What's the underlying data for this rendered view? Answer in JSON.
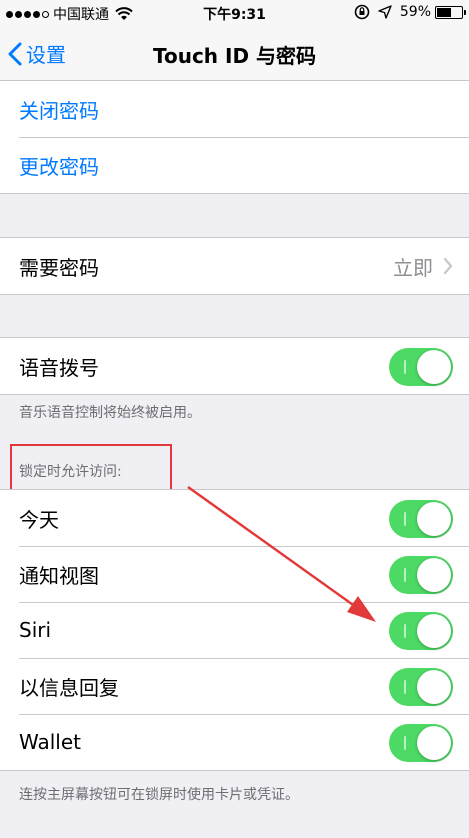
{
  "status_bar": {
    "carrier": "中国联通",
    "time": "下午9:31",
    "battery_percent": "59%",
    "battery_level": 0.59
  },
  "nav": {
    "back_label": "设置",
    "title": "Touch ID 与密码"
  },
  "passcode_group": {
    "turn_off": "关闭密码",
    "change": "更改密码"
  },
  "require_passcode": {
    "label": "需要密码",
    "value": "立即"
  },
  "voice_dial": {
    "label": "语音拨号",
    "enabled": true,
    "footnote": "音乐语音控制将始终被启用。"
  },
  "lock_access": {
    "header": "锁定时允许访问:",
    "items": [
      {
        "label": "今天",
        "enabled": true
      },
      {
        "label": "通知视图",
        "enabled": true
      },
      {
        "label": "Siri",
        "enabled": true
      },
      {
        "label": "以信息回复",
        "enabled": true
      },
      {
        "label": "Wallet",
        "enabled": true
      }
    ],
    "footnote": "连按主屏幕按钮可在锁屏时使用卡片或凭证。"
  },
  "colors": {
    "accent": "#007aff",
    "toggle_on": "#4cd964",
    "annotation": "#e23a3a"
  }
}
